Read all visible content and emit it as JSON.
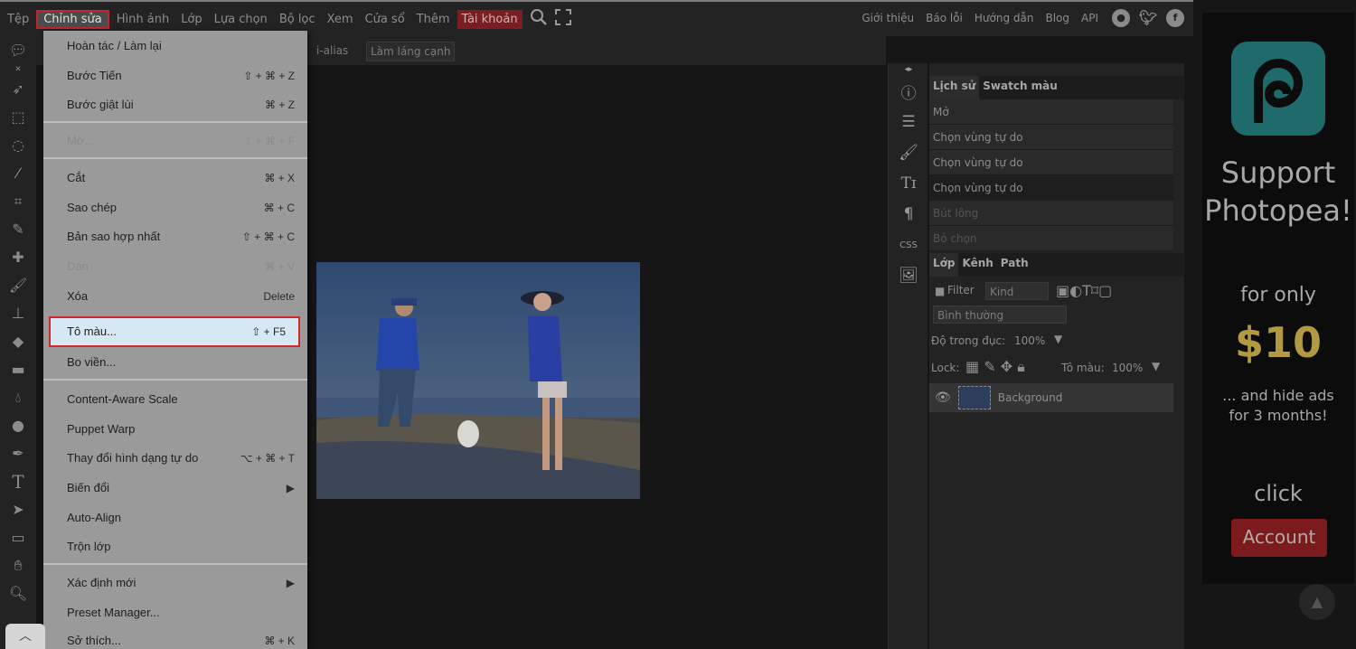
{
  "menubar": {
    "items": [
      "Tệp",
      "Chỉnh sửa",
      "Hình ảnh",
      "Lớp",
      "Lựa chọn",
      "Bộ lọc",
      "Xem",
      "Cửa sổ",
      "Thêm",
      "Tài khoản"
    ],
    "right_items": [
      "Giới thiệu",
      "Báo lỗi",
      "Hướng dẫn",
      "Blog",
      "API"
    ],
    "social": [
      "reddit-icon",
      "twitter-icon",
      "facebook-icon"
    ]
  },
  "options": {
    "antialias_label": "i-alias",
    "refine_edge_label": "Làm láng cạnh"
  },
  "edit_menu": {
    "items": [
      {
        "label": "Hoàn tác / Làm lại",
        "shortcut": "",
        "disabled": false
      },
      {
        "label": "Bước Tiến",
        "shortcut": "⇧ + ⌘ + Z",
        "disabled": false
      },
      {
        "label": "Bước giật lùi",
        "shortcut": "⌘ + Z",
        "disabled": false
      },
      {
        "label": "Mờ...",
        "shortcut": "⇧ + ⌘ + F",
        "disabled": true
      },
      {
        "label": "Cắt",
        "shortcut": "⌘ + X",
        "disabled": false
      },
      {
        "label": "Sao chép",
        "shortcut": "⌘ + C",
        "disabled": false
      },
      {
        "label": "Bản sao hợp nhất",
        "shortcut": "⇧ + ⌘ + C",
        "disabled": false
      },
      {
        "label": "Dán",
        "shortcut": "⌘ + V",
        "disabled": true
      },
      {
        "label": "Xóa",
        "shortcut": "Delete",
        "disabled": false
      },
      {
        "label": "Tô màu...",
        "shortcut": "⇧ + F5",
        "disabled": false
      },
      {
        "label": "Bo viền...",
        "shortcut": "",
        "disabled": false
      },
      {
        "label": "Content-Aware Scale",
        "shortcut": "",
        "disabled": false
      },
      {
        "label": "Puppet Warp",
        "shortcut": "",
        "disabled": false
      },
      {
        "label": "Thay đổi hình dạng tự do",
        "shortcut": "⌥ + ⌘ + T",
        "disabled": false
      },
      {
        "label": "Biến đổi",
        "shortcut": "▶",
        "disabled": false
      },
      {
        "label": "Auto-Align",
        "shortcut": "",
        "disabled": false
      },
      {
        "label": "Trộn lớp",
        "shortcut": "",
        "disabled": false
      },
      {
        "label": "Xác định mới",
        "shortcut": "▶",
        "disabled": false
      },
      {
        "label": "Preset Manager...",
        "shortcut": "",
        "disabled": false
      },
      {
        "label": "Sở thích...",
        "shortcut": "⌘ + K",
        "disabled": false
      }
    ]
  },
  "history_panel": {
    "tabs": [
      "Lịch sử",
      "Swatch màu"
    ],
    "rows": [
      "Mở",
      "Chọn vùng tự do",
      "Chọn vùng tự do",
      "Chọn vùng tự do",
      "Bút lông",
      "Bỏ chọn"
    ]
  },
  "layers_panel": {
    "tabs": [
      "Lớp",
      "Kênh",
      "Path"
    ],
    "filter_label": "Filter",
    "filter_kind": "Kind",
    "blend_mode": "Bình thường",
    "opacity_label": "Độ trong đục:",
    "opacity_value": "100%",
    "lock_label": "Lock:",
    "fill_label": "Tô màu:",
    "fill_value": "100%",
    "layer_name": "Background"
  },
  "ad": {
    "line1": "Support",
    "line2": "Photopea!",
    "for_only": "for only",
    "price": "$10",
    "hide_ads_1": "... and hide ads",
    "hide_ads_2": "for 3 months!",
    "click": "click",
    "button": "Account"
  },
  "panel_icons": [
    "info-icon",
    "properties-icon",
    "brush-settings-icon",
    "character-icon",
    "paragraph-icon",
    "css-icon",
    "image-icon"
  ],
  "css_label": "CSS",
  "colors": {
    "accent_red": "#c0262c",
    "highlight": "#d7e8f5",
    "price_gold": "#b29a43",
    "logo_teal": "#1f6b6b"
  }
}
